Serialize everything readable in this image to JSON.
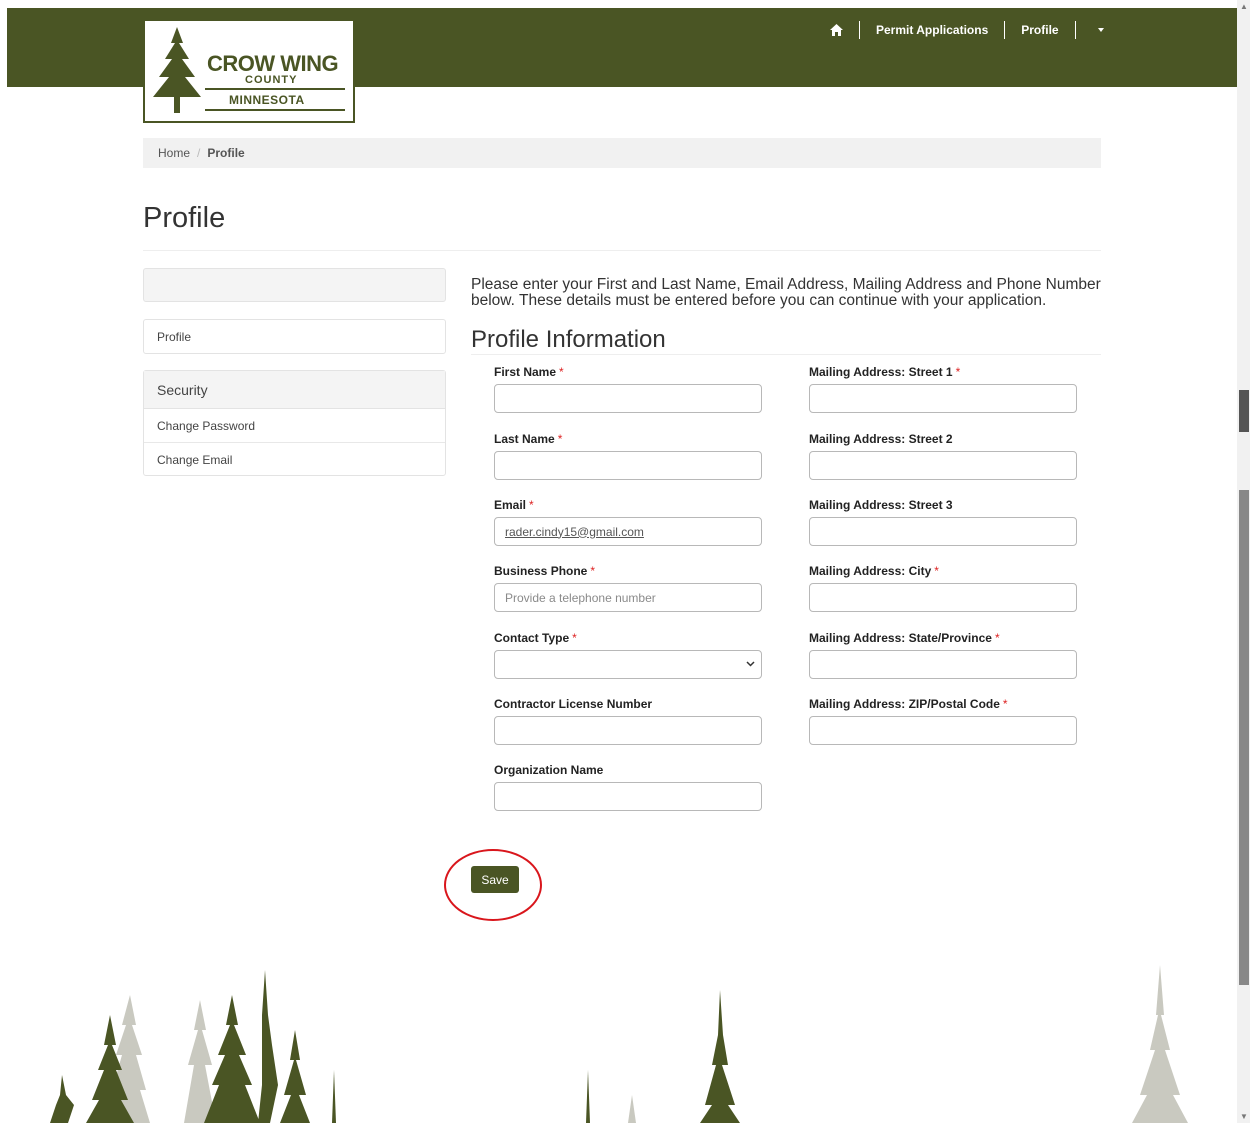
{
  "logo": {
    "line1": "CROW WING",
    "line2": "COUNTY",
    "line3": "MINNESOTA"
  },
  "nav": {
    "home_icon": "home-icon",
    "permit_applications": "Permit Applications",
    "profile": "Profile"
  },
  "breadcrumb": {
    "home": "Home",
    "separator": "/",
    "current": "Profile"
  },
  "page_title": "Profile",
  "sidebar": {
    "profile": "Profile",
    "security_heading": "Security",
    "change_password": "Change Password",
    "change_email": "Change Email"
  },
  "intro_text": "Please enter your First and Last Name, Email Address, Mailing Address and Phone Number below. These details must be entered before you can continue with your application.",
  "section_title": "Profile Information",
  "required_mark": "*",
  "form": {
    "first_name": {
      "label": "First Name",
      "value": ""
    },
    "last_name": {
      "label": "Last Name",
      "value": ""
    },
    "email": {
      "label": "Email",
      "value": "rader.cindy15@gmail.com"
    },
    "business_phone": {
      "label": "Business Phone",
      "placeholder": "Provide a telephone number"
    },
    "contact_type": {
      "label": "Contact Type",
      "value": ""
    },
    "contractor_license": {
      "label": "Contractor License Number",
      "value": ""
    },
    "organization_name": {
      "label": "Organization Name",
      "value": ""
    },
    "street1": {
      "label": "Mailing Address: Street 1",
      "value": ""
    },
    "street2": {
      "label": "Mailing Address: Street 2",
      "value": ""
    },
    "street3": {
      "label": "Mailing Address: Street 3",
      "value": ""
    },
    "city": {
      "label": "Mailing Address: City",
      "value": ""
    },
    "state": {
      "label": "Mailing Address: State/Province",
      "value": ""
    },
    "zip": {
      "label": "Mailing Address: ZIP/Postal Code",
      "value": ""
    }
  },
  "save_label": "Save",
  "colors": {
    "brand_green": "#4a5524",
    "required_red": "#d22",
    "annotation_red": "#d9161c"
  }
}
